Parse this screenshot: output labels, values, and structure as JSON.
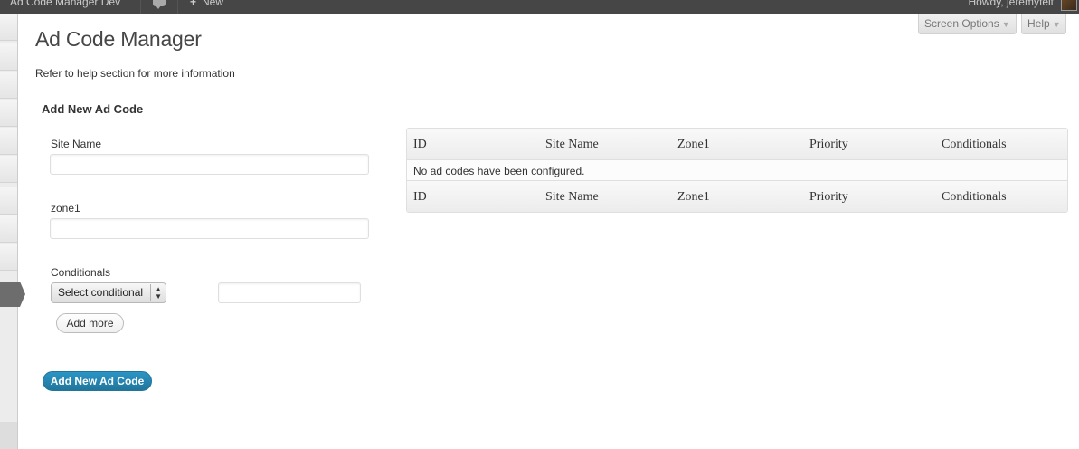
{
  "admin_bar": {
    "site_name": "Ad Code Manager Dev",
    "new_label": "New",
    "howdy": "Howdy, jeremyfelt",
    "icons": [
      "comments-icon",
      "plus-icon",
      "avatar"
    ]
  },
  "screen_meta": {
    "screen_options": "Screen Options",
    "help": "Help"
  },
  "page": {
    "title": "Ad Code Manager",
    "help_note": "Refer to help section for more information"
  },
  "form": {
    "title": "Add New Ad Code",
    "site_name_label": "Site Name",
    "site_name_value": "",
    "zone1_label": "zone1",
    "zone1_value": "",
    "conditionals_label": "Conditionals",
    "conditional_select": "Select conditional",
    "conditional_value": "",
    "add_more": "Add more",
    "submit": "Add New Ad Code"
  },
  "table": {
    "columns": [
      "ID",
      "Site Name",
      "Zone1",
      "Priority",
      "Conditionals"
    ],
    "empty_message": "No ad codes have been configured."
  },
  "colors": {
    "admin_bar": "#464646",
    "primary_button": "#21759b",
    "current_menu": "#6d6d6d"
  }
}
